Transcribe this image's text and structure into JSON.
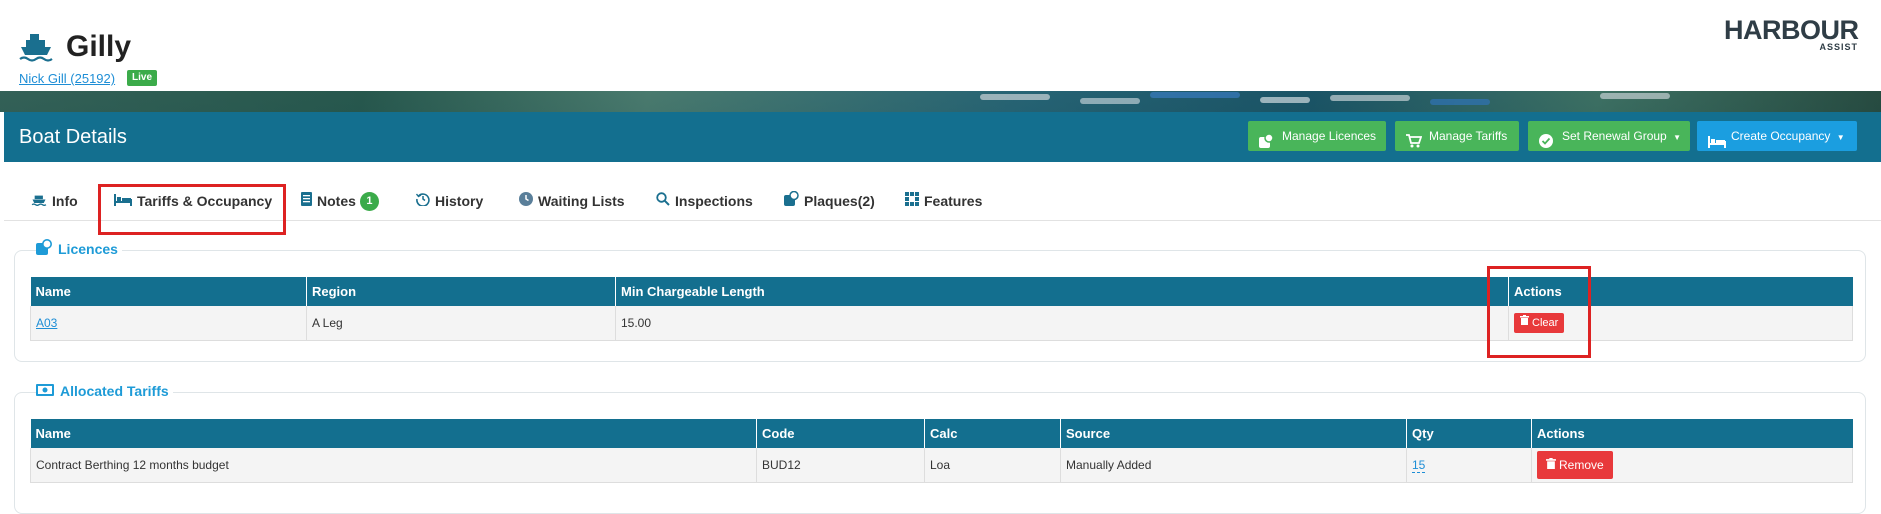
{
  "header": {
    "title": "Gilly",
    "owner_link": "Nick Gill (25192)",
    "status_badge": "Live",
    "logo_main": "HARBOUR",
    "logo_sub": "ASSIST"
  },
  "panel": {
    "title": "Boat Details",
    "buttons": {
      "manage_licences": "Manage Licences",
      "manage_tariffs": "Manage Tariffs",
      "set_renewal_group": "Set Renewal Group",
      "create_occupancy": "Create Occupancy"
    }
  },
  "tabs": [
    {
      "label": "Info"
    },
    {
      "label": "Tariffs & Occupancy"
    },
    {
      "label": "Notes",
      "badge": "1"
    },
    {
      "label": "History"
    },
    {
      "label": "Waiting Lists"
    },
    {
      "label": "Inspections"
    },
    {
      "label": "Plaques(2)"
    },
    {
      "label": "Features"
    }
  ],
  "licences": {
    "title": "Licences",
    "columns": [
      "Name",
      "Region",
      "Min Chargeable Length",
      "Actions"
    ],
    "rows": [
      {
        "name": "A03",
        "region": "A Leg",
        "min_length": "15.00",
        "action": "Clear"
      }
    ]
  },
  "tariffs": {
    "title": "Allocated Tariffs",
    "columns": [
      "Name",
      "Code",
      "Calc",
      "Source",
      "Qty",
      "Actions"
    ],
    "rows": [
      {
        "name": "Contract Berthing 12 months budget",
        "code": "BUD12",
        "calc": "Loa",
        "source": "Manually Added",
        "qty": "15",
        "action": "Remove"
      }
    ]
  },
  "colors": {
    "primary": "#136f8f",
    "accent_blue": "#1e9bd7",
    "success": "#49b55a",
    "danger": "#e8393b",
    "highlight": "#dd2222"
  }
}
